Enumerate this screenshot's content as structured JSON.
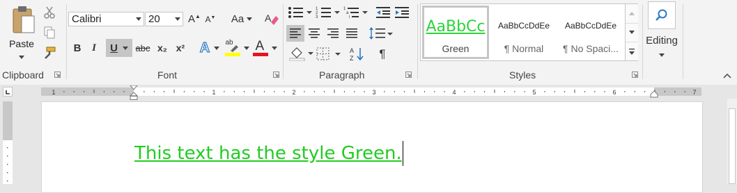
{
  "clipboard": {
    "paste_label": "Paste",
    "group_label": "Clipboard"
  },
  "font": {
    "name": "Calibri",
    "size": "20",
    "group_label": "Font",
    "change_case_label": "Aa",
    "bold": "B",
    "italic": "I",
    "underline": "U",
    "strikethrough": "abc",
    "subscript": "x₂",
    "superscript": "x²",
    "highlight_label": "ab",
    "font_color_label": "A",
    "underline_active": true,
    "highlight_color": "#ffff00",
    "font_color": "#e81123"
  },
  "paragraph": {
    "group_label": "Paragraph",
    "pilcrow": "¶",
    "align_left_active": true
  },
  "styles": {
    "group_label": "Styles",
    "tiles": [
      {
        "preview": "AaBbCc",
        "name": "Green",
        "selected": true,
        "color": "#2bd43a"
      },
      {
        "preview": "AaBbCcDdEe",
        "name": "¶ Normal",
        "selected": false
      },
      {
        "preview": "AaBbCcDdEe",
        "name": "¶ No Spaci...",
        "selected": false
      }
    ]
  },
  "editing": {
    "label": "Editing"
  },
  "ruler": {
    "numbers": [
      "1",
      "1",
      "2",
      "3",
      "4",
      "5",
      "6",
      "7"
    ]
  },
  "document": {
    "text": "This text has the style Green.",
    "text_color": "#22cc22"
  }
}
